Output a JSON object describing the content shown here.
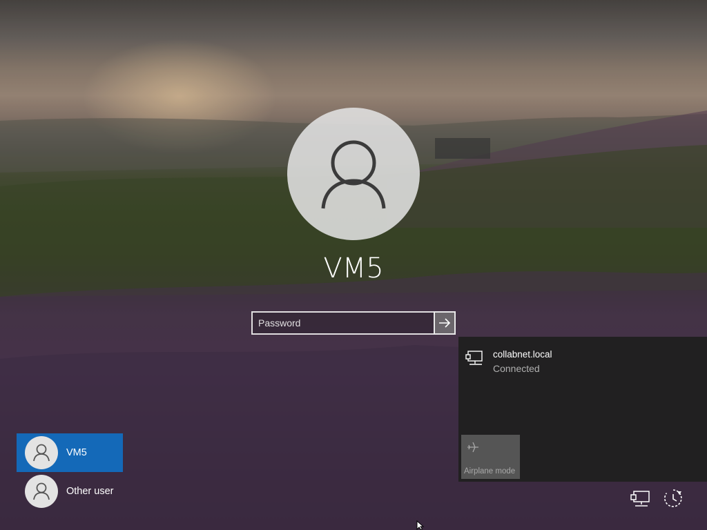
{
  "login": {
    "username": "VM5",
    "password_placeholder": "Password"
  },
  "network": {
    "name": "collabnet.local",
    "status": "Connected",
    "airplane_label": "Airplane mode"
  },
  "users": [
    {
      "label": "VM5",
      "selected": true
    },
    {
      "label": "Other user",
      "selected": false
    }
  ],
  "colors": {
    "selected_user": "#1469b8",
    "flyout_bg": "#202020",
    "tile_bg": "#555555"
  },
  "icons": {
    "avatar": "person-icon",
    "submit": "arrow-right-icon",
    "network": "ethernet-icon",
    "airplane": "airplane-icon",
    "ease_of_access": "ease-of-access-icon",
    "power": "power-icon"
  }
}
